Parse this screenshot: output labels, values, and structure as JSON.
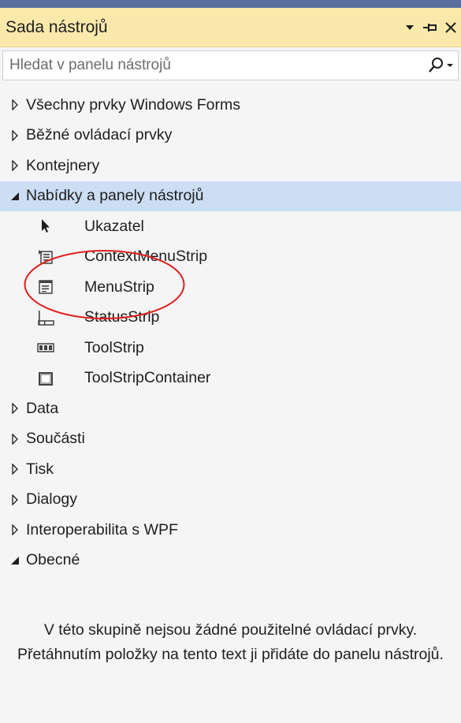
{
  "panel": {
    "title": "Sada nástrojů",
    "buttons": {
      "dropdown_icon": "chevron-down-icon",
      "pin_icon": "pin-icon",
      "close_icon": "close-icon"
    }
  },
  "search": {
    "placeholder": "Hledat v panelu nástrojů",
    "value": "",
    "icon": "search-icon"
  },
  "groups_before": [
    {
      "label": "Všechny prvky Windows Forms",
      "expanded": false
    },
    {
      "label": "Běžné ovládací prvky",
      "expanded": false
    },
    {
      "label": "Kontejnery",
      "expanded": false
    }
  ],
  "active_group": {
    "label": "Nabídky a panely nástrojů",
    "expanded": true,
    "items": [
      {
        "label": "Ukazatel",
        "icon": "pointer-icon"
      },
      {
        "label": "ContextMenuStrip",
        "icon": "context-menu-icon"
      },
      {
        "label": "MenuStrip",
        "icon": "menustrip-icon"
      },
      {
        "label": "StatusStrip",
        "icon": "statusstrip-icon"
      },
      {
        "label": "ToolStrip",
        "icon": "toolstrip-icon"
      },
      {
        "label": "ToolStripContainer",
        "icon": "toolstrip-container-icon"
      }
    ]
  },
  "groups_after": [
    {
      "label": "Data",
      "expanded": false
    },
    {
      "label": "Součásti",
      "expanded": false
    },
    {
      "label": "Tisk",
      "expanded": false
    },
    {
      "label": "Dialogy",
      "expanded": false
    },
    {
      "label": "Interoperabilita s WPF",
      "expanded": false
    }
  ],
  "general_group": {
    "label": "Obecné",
    "expanded": true,
    "empty_message": "V této skupině nejsou žádné použitelné ovládací prvky. Přetáhnutím položky na tento text ji přidáte do panelu nástrojů."
  },
  "colors": {
    "accent_bar": "#5b6f9e",
    "title_bg": "#fbe9ac",
    "selected_group_bg": "#ccdef4",
    "annotation_circle": "#e0201f"
  }
}
